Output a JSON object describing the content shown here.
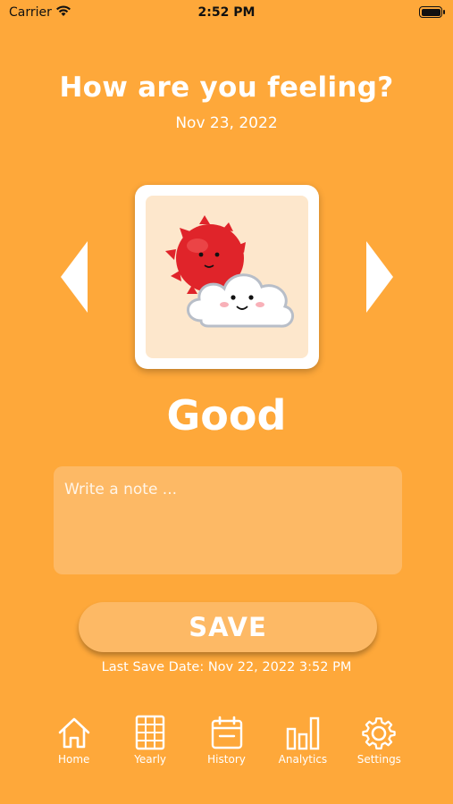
{
  "status_bar": {
    "carrier": "Carrier",
    "time": "2:52 PM",
    "wifi_icon": "wifi-icon",
    "battery_icon": "battery-icon"
  },
  "header": {
    "title": "How are you feeling?",
    "date": "Nov 23, 2022"
  },
  "mood": {
    "label": "Good",
    "illustration": "sun-behind-cloud",
    "prev_icon": "triangle-left-icon",
    "next_icon": "triangle-right-icon"
  },
  "note": {
    "placeholder": "Write a note ...",
    "value": ""
  },
  "save": {
    "label": "SAVE",
    "last_save": "Last Save Date: Nov 22, 2022 3:52 PM"
  },
  "tabs": [
    {
      "label": "Home",
      "icon": "home-icon"
    },
    {
      "label": "Yearly",
      "icon": "grid-calendar-icon"
    },
    {
      "label": "History",
      "icon": "calendar-icon"
    },
    {
      "label": "Analytics",
      "icon": "bar-chart-icon"
    },
    {
      "label": "Settings",
      "icon": "gear-icon"
    }
  ],
  "colors": {
    "background": "#FEA83A",
    "panel": "#FDB965",
    "card_inner": "#FDE7CC",
    "sun": "#E0242A",
    "text": "#FFFFFF"
  }
}
